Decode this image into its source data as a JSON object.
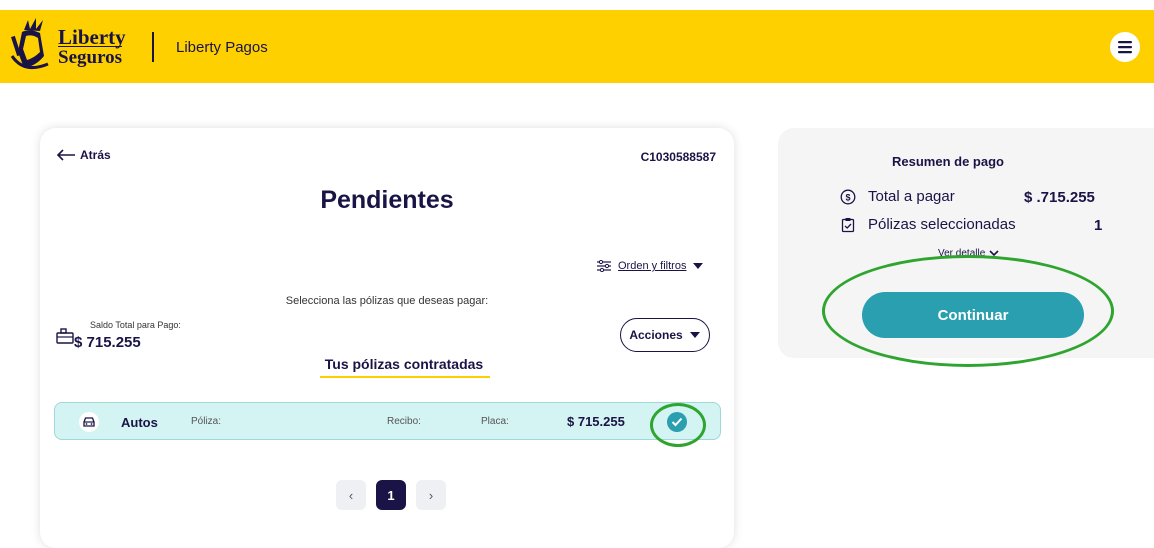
{
  "header": {
    "logo_line1": "Liberty",
    "logo_line2": "Seguros",
    "title": "Liberty Pagos"
  },
  "card": {
    "back_label": "Atrás",
    "client_id": "C1030588587",
    "title": "Pendientes",
    "filters_label": "Orden y filtros",
    "select_hint": "Selecciona las pólizas que deseas pagar:",
    "saldo_label": "Saldo Total para Pago:",
    "saldo_amount": "$ 715.255",
    "acciones_label": "Acciones",
    "tab_title": "Tus pólizas contratadas",
    "policy": {
      "type": "Autos",
      "poliza_label": "Póliza:",
      "recibo_label": "Recibo:",
      "placa_label": "Placa:",
      "amount": "$ 715.255",
      "selected": true
    },
    "pagination": {
      "prev": "‹",
      "current": "1",
      "next": "›"
    }
  },
  "summary": {
    "title": "Resumen de pago",
    "total_label": "Total a pagar",
    "total_value": "$ .715.255",
    "polizas_label": "Pólizas seleccionadas",
    "polizas_value": "1",
    "detail_label": "Ver detalle",
    "continue_label": "Continuar"
  },
  "colors": {
    "brand_yellow": "#ffd000",
    "navy": "#1a1446",
    "teal": "#2a9fb0",
    "row_bg": "#d4f3f3",
    "annotation_green": "#2fa52f"
  },
  "icons": [
    "liberty-logo-icon",
    "hamburger-menu-icon",
    "arrow-left-icon",
    "filter-sliders-icon",
    "caret-down-icon",
    "wallet-icon",
    "car-icon",
    "check-icon",
    "dollar-circle-icon",
    "clipboard-check-icon",
    "chevron-down-icon"
  ]
}
